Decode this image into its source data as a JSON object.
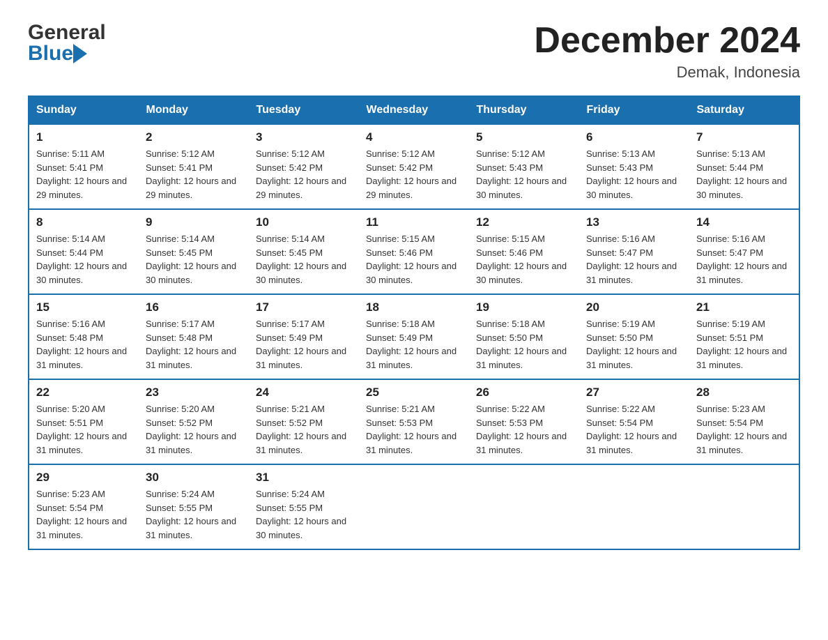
{
  "logo": {
    "general": "General",
    "blue": "Blue",
    "arrow": true
  },
  "header": {
    "title": "December 2024",
    "location": "Demak, Indonesia"
  },
  "weekdays": [
    "Sunday",
    "Monday",
    "Tuesday",
    "Wednesday",
    "Thursday",
    "Friday",
    "Saturday"
  ],
  "weeks": [
    [
      {
        "day": "1",
        "sunrise": "5:11 AM",
        "sunset": "5:41 PM",
        "daylight": "12 hours and 29 minutes."
      },
      {
        "day": "2",
        "sunrise": "5:12 AM",
        "sunset": "5:41 PM",
        "daylight": "12 hours and 29 minutes."
      },
      {
        "day": "3",
        "sunrise": "5:12 AM",
        "sunset": "5:42 PM",
        "daylight": "12 hours and 29 minutes."
      },
      {
        "day": "4",
        "sunrise": "5:12 AM",
        "sunset": "5:42 PM",
        "daylight": "12 hours and 29 minutes."
      },
      {
        "day": "5",
        "sunrise": "5:12 AM",
        "sunset": "5:43 PM",
        "daylight": "12 hours and 30 minutes."
      },
      {
        "day": "6",
        "sunrise": "5:13 AM",
        "sunset": "5:43 PM",
        "daylight": "12 hours and 30 minutes."
      },
      {
        "day": "7",
        "sunrise": "5:13 AM",
        "sunset": "5:44 PM",
        "daylight": "12 hours and 30 minutes."
      }
    ],
    [
      {
        "day": "8",
        "sunrise": "5:14 AM",
        "sunset": "5:44 PM",
        "daylight": "12 hours and 30 minutes."
      },
      {
        "day": "9",
        "sunrise": "5:14 AM",
        "sunset": "5:45 PM",
        "daylight": "12 hours and 30 minutes."
      },
      {
        "day": "10",
        "sunrise": "5:14 AM",
        "sunset": "5:45 PM",
        "daylight": "12 hours and 30 minutes."
      },
      {
        "day": "11",
        "sunrise": "5:15 AM",
        "sunset": "5:46 PM",
        "daylight": "12 hours and 30 minutes."
      },
      {
        "day": "12",
        "sunrise": "5:15 AM",
        "sunset": "5:46 PM",
        "daylight": "12 hours and 30 minutes."
      },
      {
        "day": "13",
        "sunrise": "5:16 AM",
        "sunset": "5:47 PM",
        "daylight": "12 hours and 31 minutes."
      },
      {
        "day": "14",
        "sunrise": "5:16 AM",
        "sunset": "5:47 PM",
        "daylight": "12 hours and 31 minutes."
      }
    ],
    [
      {
        "day": "15",
        "sunrise": "5:16 AM",
        "sunset": "5:48 PM",
        "daylight": "12 hours and 31 minutes."
      },
      {
        "day": "16",
        "sunrise": "5:17 AM",
        "sunset": "5:48 PM",
        "daylight": "12 hours and 31 minutes."
      },
      {
        "day": "17",
        "sunrise": "5:17 AM",
        "sunset": "5:49 PM",
        "daylight": "12 hours and 31 minutes."
      },
      {
        "day": "18",
        "sunrise": "5:18 AM",
        "sunset": "5:49 PM",
        "daylight": "12 hours and 31 minutes."
      },
      {
        "day": "19",
        "sunrise": "5:18 AM",
        "sunset": "5:50 PM",
        "daylight": "12 hours and 31 minutes."
      },
      {
        "day": "20",
        "sunrise": "5:19 AM",
        "sunset": "5:50 PM",
        "daylight": "12 hours and 31 minutes."
      },
      {
        "day": "21",
        "sunrise": "5:19 AM",
        "sunset": "5:51 PM",
        "daylight": "12 hours and 31 minutes."
      }
    ],
    [
      {
        "day": "22",
        "sunrise": "5:20 AM",
        "sunset": "5:51 PM",
        "daylight": "12 hours and 31 minutes."
      },
      {
        "day": "23",
        "sunrise": "5:20 AM",
        "sunset": "5:52 PM",
        "daylight": "12 hours and 31 minutes."
      },
      {
        "day": "24",
        "sunrise": "5:21 AM",
        "sunset": "5:52 PM",
        "daylight": "12 hours and 31 minutes."
      },
      {
        "day": "25",
        "sunrise": "5:21 AM",
        "sunset": "5:53 PM",
        "daylight": "12 hours and 31 minutes."
      },
      {
        "day": "26",
        "sunrise": "5:22 AM",
        "sunset": "5:53 PM",
        "daylight": "12 hours and 31 minutes."
      },
      {
        "day": "27",
        "sunrise": "5:22 AM",
        "sunset": "5:54 PM",
        "daylight": "12 hours and 31 minutes."
      },
      {
        "day": "28",
        "sunrise": "5:23 AM",
        "sunset": "5:54 PM",
        "daylight": "12 hours and 31 minutes."
      }
    ],
    [
      {
        "day": "29",
        "sunrise": "5:23 AM",
        "sunset": "5:54 PM",
        "daylight": "12 hours and 31 minutes."
      },
      {
        "day": "30",
        "sunrise": "5:24 AM",
        "sunset": "5:55 PM",
        "daylight": "12 hours and 31 minutes."
      },
      {
        "day": "31",
        "sunrise": "5:24 AM",
        "sunset": "5:55 PM",
        "daylight": "12 hours and 30 minutes."
      },
      null,
      null,
      null,
      null
    ]
  ]
}
